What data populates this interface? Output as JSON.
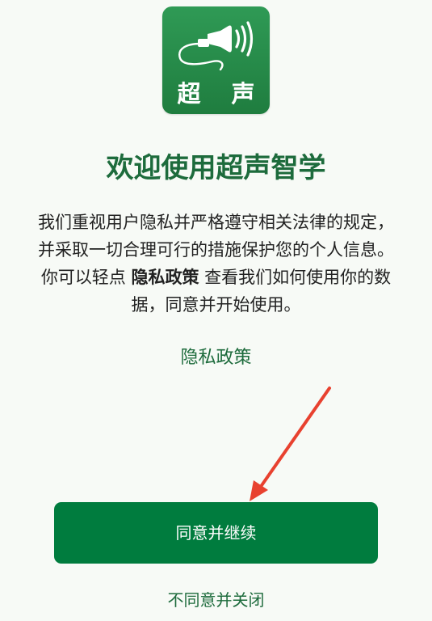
{
  "logo": {
    "icon": "ultrasound-probe-icon",
    "text": "超 声",
    "colors": {
      "top": "#2f9a55",
      "bottom": "#1f7d3f"
    }
  },
  "title": "欢迎使用超声智学",
  "description": {
    "before": "我们重视用户隐私并严格遵守相关法律的规定，并采取一切合理可行的措施保护您的个人信息。 你可以轻点 ",
    "highlight": "隐私政策",
    "after": " 查看我们如何使用你的数据，同意并开始使用。"
  },
  "policy_link": "隐私政策",
  "agree_button": "同意并继续",
  "decline_link": "不同意并关闭",
  "colors": {
    "background": "#f7faf6",
    "accent": "#007c3e",
    "link": "#1d6b3c",
    "annotation_arrow": "#e8412f"
  }
}
